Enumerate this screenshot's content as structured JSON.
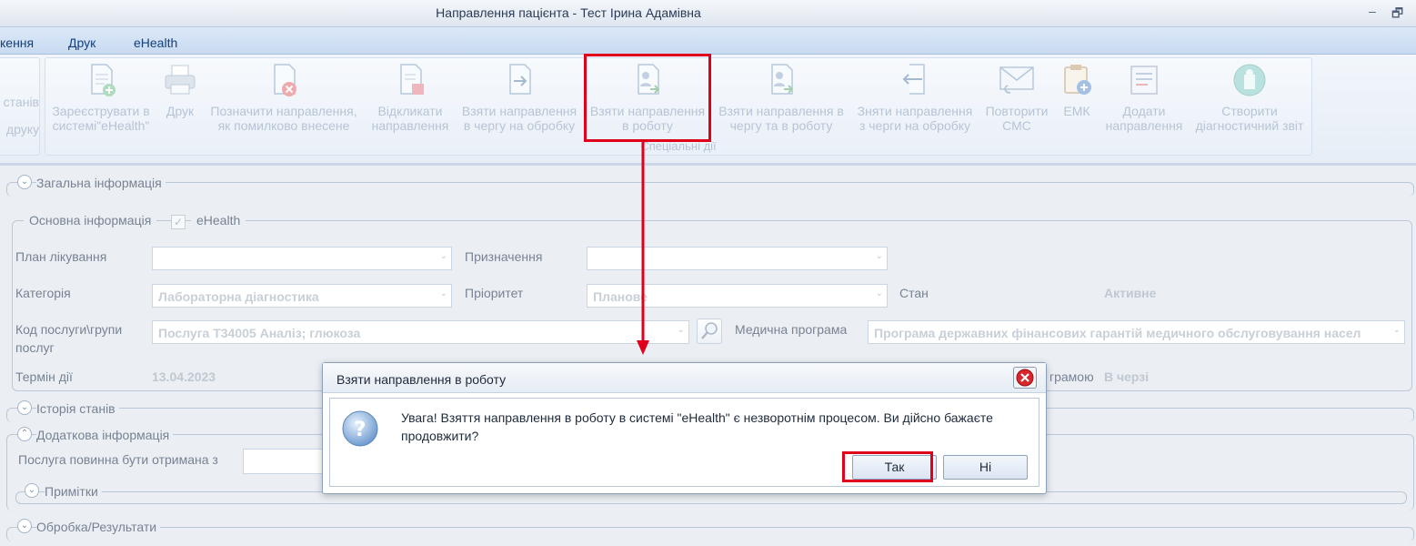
{
  "window": {
    "title": "Направлення пацієнта - Тест Ірина Адамівна",
    "minimize_glyph": "–",
    "restore_glyph": "🗗"
  },
  "menu": {
    "items": [
      "кення",
      "Друк",
      "eHealth"
    ]
  },
  "ribbon": {
    "left_group": {
      "line1": "станів",
      "line2": "друку"
    },
    "group_label": "Спеціальні дії",
    "buttons": [
      {
        "line1": "Зареєструвати в",
        "line2": "системі\"eHealth\"",
        "icon": "register-document-icon"
      },
      {
        "line1": "Друк",
        "line2": "",
        "icon": "printer-icon"
      },
      {
        "line1": "Позначити направлення,",
        "line2": "як помилково внесене",
        "icon": "cancel-document-icon"
      },
      {
        "line1": "Відкликати",
        "line2": "направлення",
        "icon": "revoke-document-icon"
      },
      {
        "line1": "Взяти направлення",
        "line2": "в чергу на обробку",
        "icon": "queue-document-icon"
      },
      {
        "line1": "Взяти направлення",
        "line2": "в роботу",
        "icon": "take-to-work-icon"
      },
      {
        "line1": "Взяти направлення в",
        "line2": "чергу та в роботу",
        "icon": "queue-and-work-icon"
      },
      {
        "line1": "Зняти направлення",
        "line2": "з черги на обробку",
        "icon": "remove-from-queue-icon"
      },
      {
        "line1": "Повторити",
        "line2": "СМС",
        "icon": "envelope-icon"
      },
      {
        "line1": "ЕМК",
        "line2": "",
        "icon": "medical-record-icon"
      },
      {
        "line1": "Додати",
        "line2": "направлення",
        "icon": "add-referral-icon"
      },
      {
        "line1": "Створити",
        "line2": "діагностичний звіт",
        "icon": "diagnostic-report-icon"
      }
    ]
  },
  "sections": {
    "general": "Загальна інформація",
    "basic_info": "Основна інформація",
    "ehealth_label": "eHealth",
    "ehealth_checked": true,
    "history": "Історія станів",
    "additional": "Додаткова інформація",
    "notes": "Примітки",
    "processing": "Обробка/Результати"
  },
  "form": {
    "treatment_plan_label": "План лікування",
    "treatment_plan_value": "",
    "purpose_label": "Призначення",
    "purpose_value": "",
    "category_label": "Категорія",
    "category_value": "Лабораторна діагностика",
    "priority_label": "Пріоритет",
    "priority_value": "Планове",
    "state_label": "Стан",
    "state_value": "Активне",
    "service_code_label_1": "Код послуги\\групи",
    "service_code_label_2": "послуг",
    "service_code_value": "Послуга Т34005 Аналіз; глюкоза",
    "medical_program_label": "Медична програма",
    "medical_program_value": "Програма державних фінансових гарантій медичного обслуговування насел",
    "term_label": "Термін дії",
    "term_value": "13.04.2023",
    "program_status_label": "грамою",
    "program_status_value": "В черзі",
    "service_from_label": "Послуга повинна бути отримана з"
  },
  "dialog": {
    "title": "Взяти направлення в роботу",
    "message": "Увага! Взяття направлення в роботу в системі \"eHealth\" є незворотнім процесом. Ви дійсно бажаєте продовжити?",
    "yes_label": "Так",
    "no_label": "Ні"
  },
  "colors": {
    "highlight": "#e0001b",
    "ribbon_text_disabled": "#8ba0bb",
    "accent_blue": "#15407a"
  }
}
